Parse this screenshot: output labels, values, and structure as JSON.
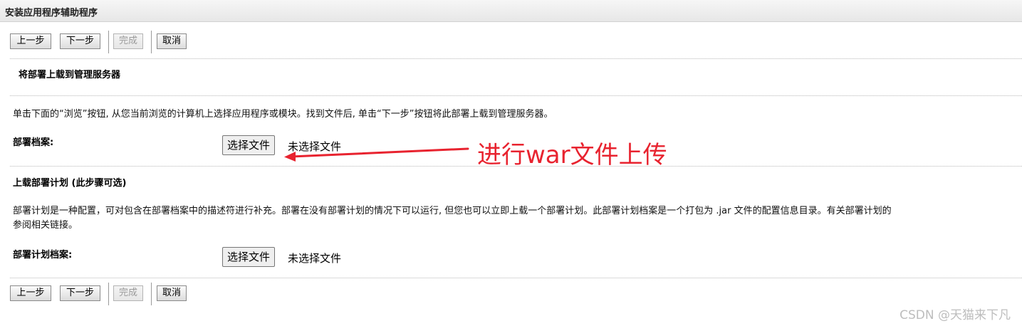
{
  "window": {
    "title": "安装应用程序辅助程序"
  },
  "toolbar": {
    "prev_label": "上一步",
    "next_label": "下一步",
    "finish_label": "完成",
    "cancel_label": "取消"
  },
  "section_upload": {
    "heading": "将部署上载到管理服务器",
    "instruction": "单击下面的“浏览”按钮, 从您当前浏览的计算机上选择应用程序或模块。找到文件后, 单击“下一步”按钮将此部署上载到管理服务器。",
    "archive_label": "部署档案:",
    "choose_file_label": "选择文件",
    "no_file_text": "未选择文件"
  },
  "section_plan": {
    "heading": "上载部署计划 (此步骤可选)",
    "description_line1": "部署计划是一种配置，可对包含在部署档案中的描述符进行补充。部署在没有部署计划的情况下可以运行, 但您也可以立即上载一个部署计划。此部署计划档案是一个打包为 .jar 文件的配置信息目录。有关部署计划的",
    "description_line2": "参阅相关链接。",
    "plan_label": "部署计划档案:",
    "choose_file_label": "选择文件",
    "no_file_text": "未选择文件"
  },
  "annotation": {
    "text": "进行war文件上传",
    "color": "#e8232f"
  },
  "watermark": {
    "text": "CSDN @天猫来下凡"
  }
}
